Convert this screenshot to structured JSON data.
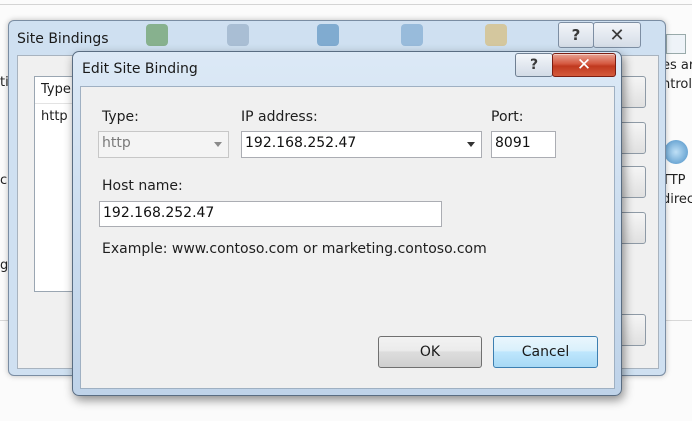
{
  "background": {
    "side_texts_left": [
      "ti",
      "c",
      "g"
    ],
    "side_texts_right": [
      "es ar",
      "ntrol",
      "TTP",
      "direc"
    ]
  },
  "site_bindings": {
    "title": "Site Bindings",
    "help_glyph": "?",
    "close_glyph": "✕",
    "list_header_type": "Type",
    "list_row_type": "http"
  },
  "edit_binding": {
    "title": "Edit Site Binding",
    "help_glyph": "?",
    "close_glyph": "✕",
    "type_label": "Type:",
    "type_value": "http",
    "ip_label": "IP address:",
    "ip_value": "192.168.252.47",
    "port_label": "Port:",
    "port_value": "8091",
    "host_label": "Host name:",
    "host_value": "192.168.252.47",
    "example_text": "Example: www.contoso.com or marketing.contoso.com",
    "ok_label": "OK",
    "cancel_label": "Cancel"
  },
  "colors": {
    "title_bar": "#c9dbee",
    "close_button": "#c0391f",
    "default_button_border": "#3c7fb1"
  }
}
